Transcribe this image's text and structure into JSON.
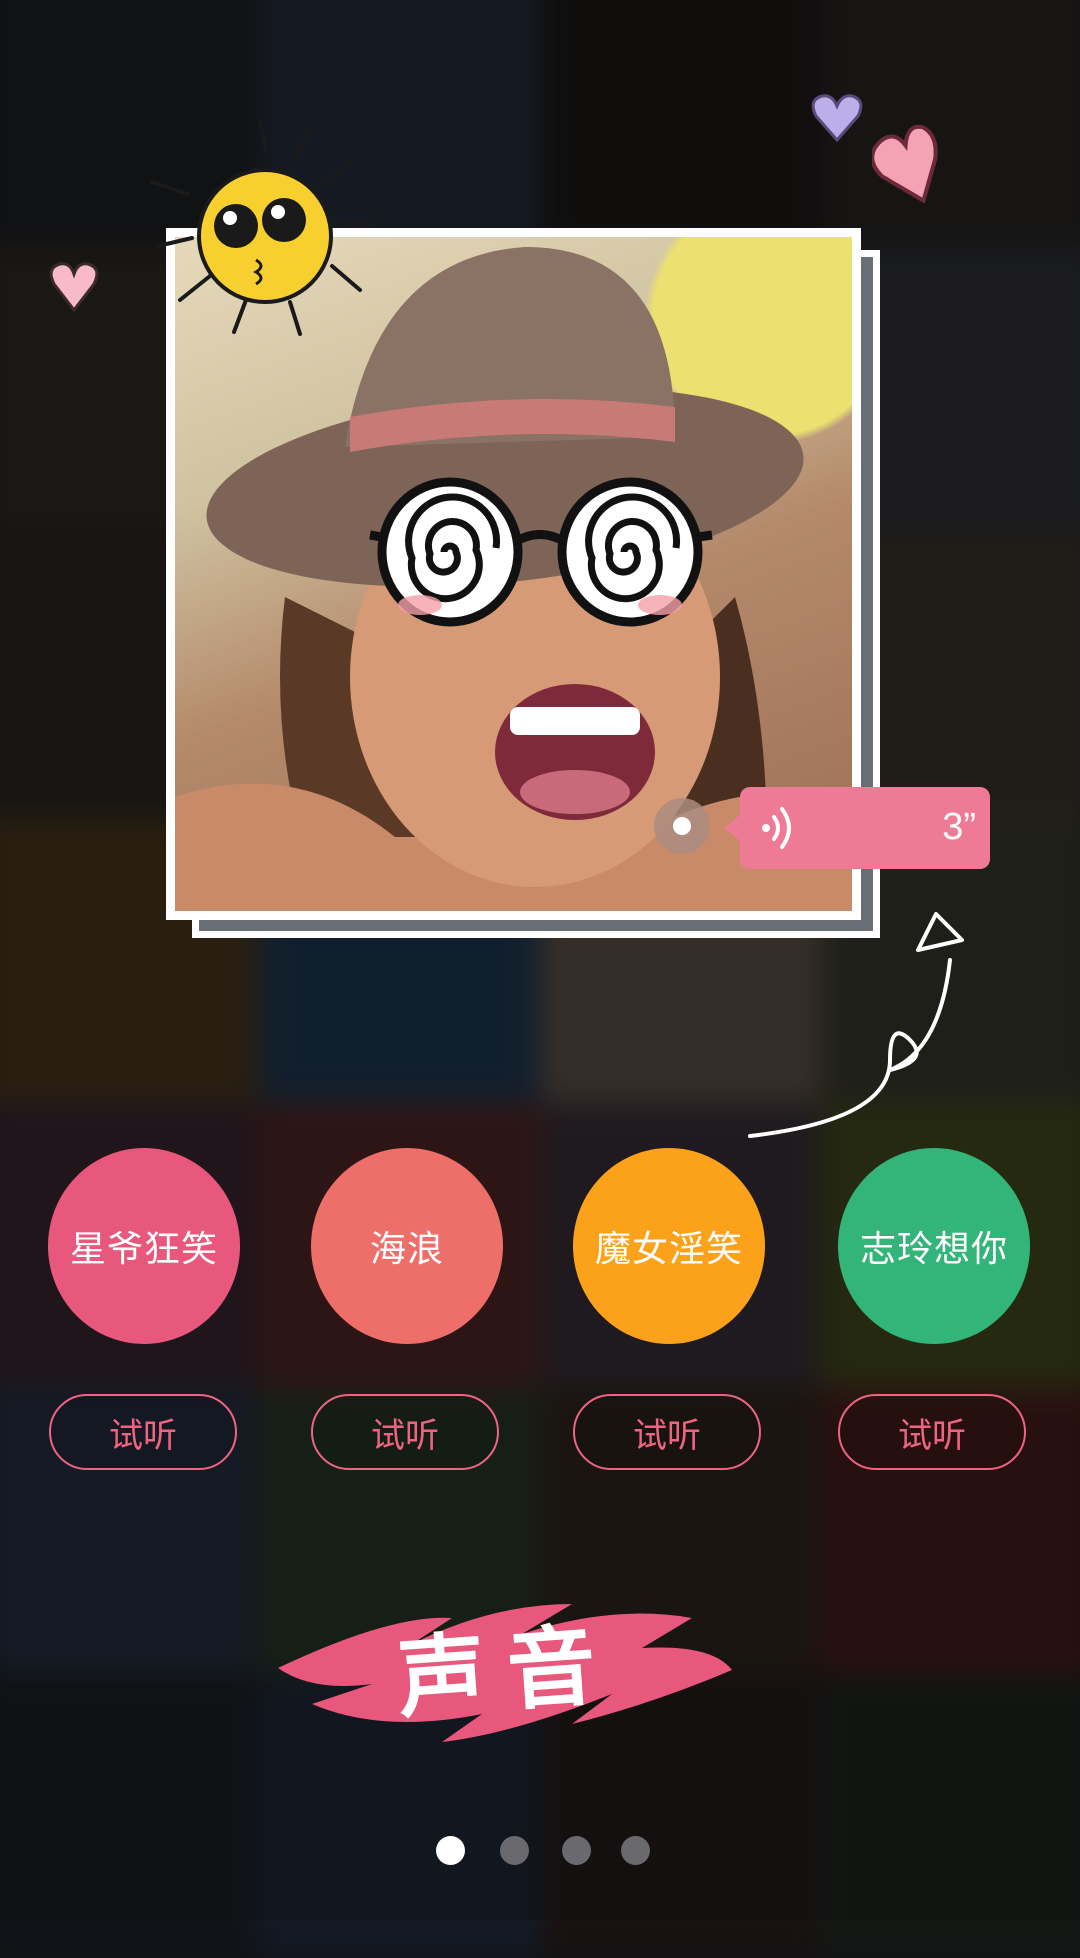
{
  "photo_card": {
    "sticker": "spiral-glasses",
    "voice_note": {
      "duration": "3”",
      "icon": "sound-wave-icon"
    }
  },
  "sounds": [
    {
      "label": "星爷狂笑",
      "color": "#e8587c"
    },
    {
      "label": "海浪",
      "color": "#ee6f6a"
    },
    {
      "label": "魔女淫笑",
      "color": "#fba21a"
    },
    {
      "label": "志玲想你",
      "color": "#33b57a"
    }
  ],
  "listen_label": "试听",
  "title": "声音",
  "pager": {
    "total": 4,
    "active_index": 0
  },
  "colors": {
    "accent": "#ef6480",
    "bubble": "#ef7a95"
  }
}
